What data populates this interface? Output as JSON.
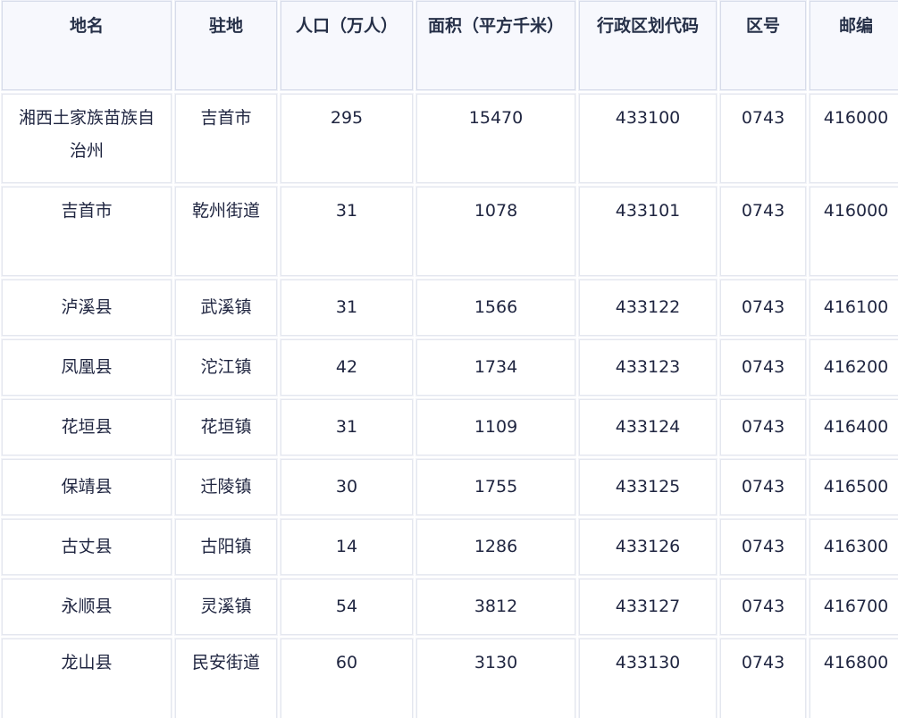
{
  "table": {
    "headers": [
      "地名",
      "驻地",
      "人口（万人）",
      "面积（平方千米）",
      "行政区划代码",
      "区号",
      "邮编"
    ],
    "rows": [
      [
        "湘西土家族苗族自治州",
        "吉首市",
        "295",
        "15470",
        "433100",
        "0743",
        "416000"
      ],
      [
        "吉首市",
        "乾州街道",
        "31",
        "1078",
        "433101",
        "0743",
        "416000"
      ],
      [
        "泸溪县",
        "武溪镇",
        "31",
        "1566",
        "433122",
        "0743",
        "416100"
      ],
      [
        "凤凰县",
        "沱江镇",
        "42",
        "1734",
        "433123",
        "0743",
        "416200"
      ],
      [
        "花垣县",
        "花垣镇",
        "31",
        "1109",
        "433124",
        "0743",
        "416400"
      ],
      [
        "保靖县",
        "迁陵镇",
        "30",
        "1755",
        "433125",
        "0743",
        "416500"
      ],
      [
        "古丈县",
        "古阳镇",
        "14",
        "1286",
        "433126",
        "0743",
        "416300"
      ],
      [
        "永顺县",
        "灵溪镇",
        "54",
        "3812",
        "433127",
        "0743",
        "416700"
      ],
      [
        "龙山县",
        "民安街道",
        "60",
        "3130",
        "433130",
        "0743",
        "416800"
      ]
    ]
  }
}
